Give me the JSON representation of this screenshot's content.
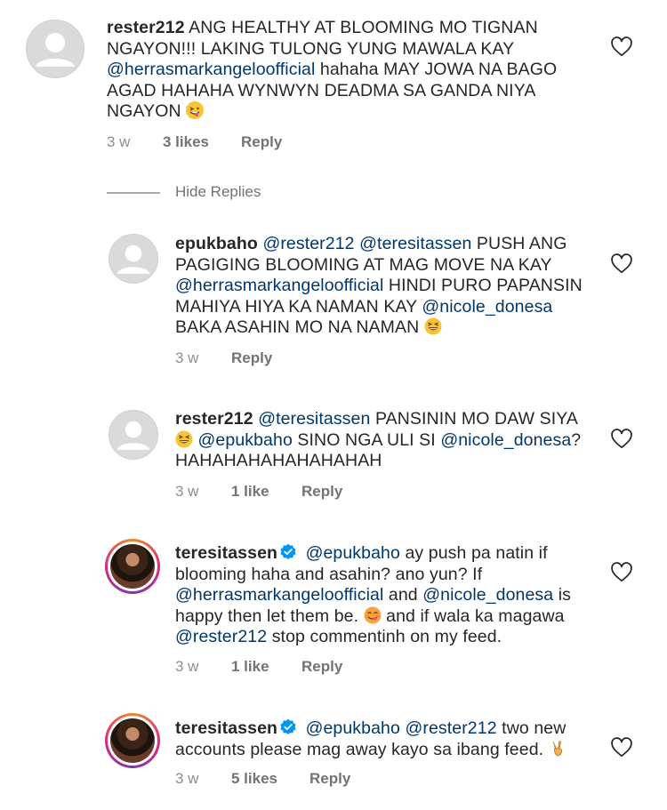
{
  "comments": [
    {
      "username": "rester212",
      "text_parts": [
        " ANG HEALTHY AT BLOOMING MO TIGNAN NGAYON!!! LAKING TULONG YUNG MAWALA KAY ",
        "@herrasmarkangeloofficial",
        " hahaha MAY JOWA NA BAGO AGAD HAHAHA WYNWYN DEADMA SA GANDA NIYA NGAYON "
      ],
      "emoji": "winking-face-with-tongue",
      "time": "3 w",
      "likes": "3 likes",
      "reply": "Reply"
    },
    {
      "username": "epukbaho",
      "text_parts": [
        "@rester212",
        " ",
        "@teresitassen",
        " PUSH ANG PAGIGING BLOOMING AT MAG MOVE NA KAY ",
        "@herrasmarkangeloofficial",
        " HINDI PURO PAPANSIN MAHIYA HIYA KA NAMAN KAY ",
        "@nicole_donesa",
        " BAKA ASAHIN MO NA NAMAN "
      ],
      "emoji": "grinning-squinting-face",
      "time": "3 w",
      "likes": "",
      "reply": "Reply"
    },
    {
      "username": "rester212",
      "text_parts": [
        "@teresitassen",
        " PANSININ MO DAW SIYA ",
        "@epukbaho",
        " SINO NGA ULI SI ",
        "@nicole_donesa",
        "? HAHAHAHAHAHAHAHAH"
      ],
      "emoji": "grinning-squinting-face",
      "time": "3 w",
      "likes": "1 like",
      "reply": "Reply"
    },
    {
      "username": "teresitassen",
      "text_parts": [
        "@epukbaho",
        " ay push pa natin if blooming haha and asahin? ano yun? If ",
        "@herrasmarkangeloofficial",
        " and ",
        "@nicole_donesa",
        " is happy then let them be. ",
        " and if wala ka magawa ",
        "@rester212",
        " stop commentinh on my feed."
      ],
      "emoji": "face-savoring-food",
      "time": "3 w",
      "likes": "1 like",
      "reply": "Reply"
    },
    {
      "username": "teresitassen",
      "text_parts": [
        "@epukbaho",
        " ",
        "@rester212",
        " two new accounts please mag away kayo sa ibang feed. "
      ],
      "emoji": "victory-hand",
      "time": "3 w",
      "likes": "5 likes",
      "reply": "Reply"
    }
  ],
  "hide_replies": "Hide Replies",
  "icons": {
    "heart": "heart-outline-icon",
    "verified": "verified-badge-icon"
  },
  "colors": {
    "mention": "#00376b",
    "verified": "#0095f6",
    "meta": "#8e8e8e"
  }
}
